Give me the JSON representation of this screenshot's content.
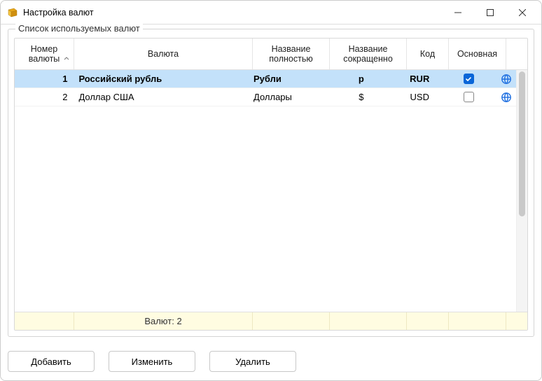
{
  "window": {
    "title": "Настройка валют"
  },
  "group": {
    "label": "Список используемых валют"
  },
  "columns": {
    "number": "Номер\nвалюты",
    "currency": "Валюта",
    "full": "Название\nполностью",
    "short": "Название\nсокращенно",
    "code": "Код",
    "main": "Основная"
  },
  "rows": [
    {
      "number": "1",
      "currency": "Российский рубль",
      "full": "Рубли",
      "short": "р",
      "code": "RUR",
      "main": true,
      "selected": true
    },
    {
      "number": "2",
      "currency": "Доллар США",
      "full": "Доллары",
      "short": "$",
      "code": "USD",
      "main": false,
      "selected": false
    }
  ],
  "footer": {
    "count_label": "Валют: 2"
  },
  "buttons": {
    "add": "Добавить",
    "edit": "Изменить",
    "delete": "Удалить"
  }
}
